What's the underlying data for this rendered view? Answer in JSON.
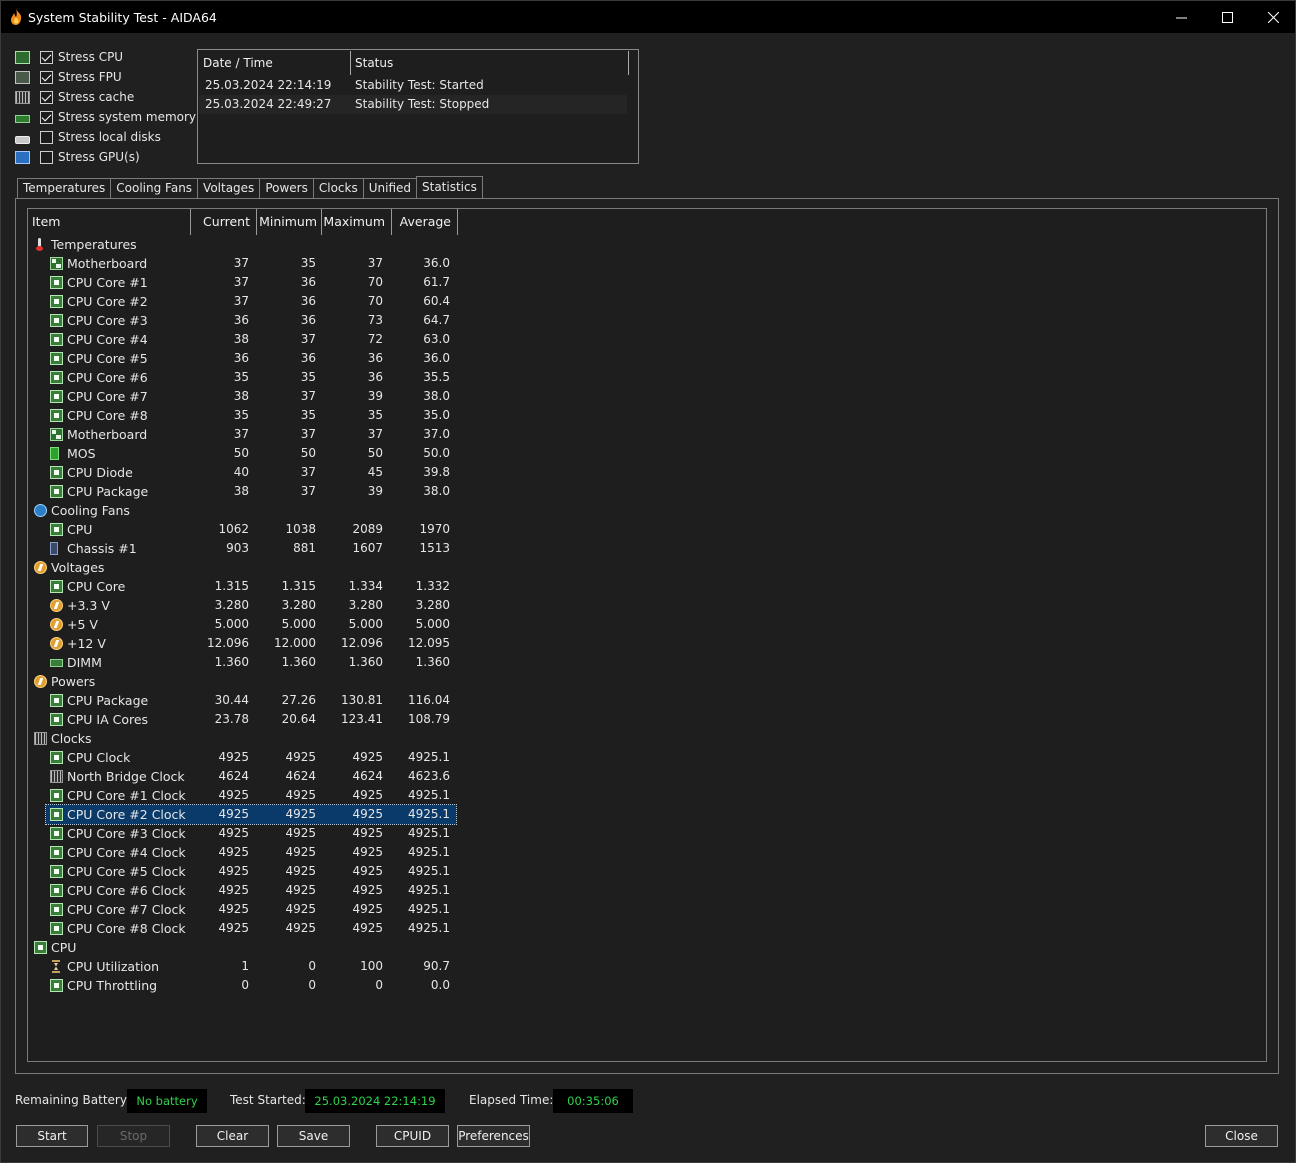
{
  "window": {
    "title": "System Stability Test - AIDA64"
  },
  "stress_options": [
    {
      "label": "Stress CPU",
      "checked": true,
      "icon": "cpu-icon"
    },
    {
      "label": "Stress FPU",
      "checked": true,
      "icon": "fpu-icon"
    },
    {
      "label": "Stress cache",
      "checked": true,
      "icon": "cache-icon"
    },
    {
      "label": "Stress system memory",
      "checked": true,
      "icon": "memory-icon"
    },
    {
      "label": "Stress local disks",
      "checked": false,
      "icon": "disk-icon"
    },
    {
      "label": "Stress GPU(s)",
      "checked": false,
      "icon": "gpu-icon"
    }
  ],
  "log": {
    "columns": [
      "Date / Time",
      "Status"
    ],
    "rows": [
      [
        "25.03.2024 22:14:19",
        "Stability Test: Started"
      ],
      [
        "25.03.2024 22:49:27",
        "Stability Test: Stopped"
      ]
    ]
  },
  "tabs": [
    "Temperatures",
    "Cooling Fans",
    "Voltages",
    "Powers",
    "Clocks",
    "Unified",
    "Statistics"
  ],
  "active_tab": "Statistics",
  "grid": {
    "columns": [
      "Item",
      "Current",
      "Minimum",
      "Maximum",
      "Average"
    ],
    "rows": [
      {
        "group": true,
        "icon": "therm",
        "name": "Temperatures"
      },
      {
        "icon": "mb",
        "name": "Motherboard",
        "cur": "37",
        "min": "35",
        "max": "37",
        "avg": "36.0"
      },
      {
        "icon": "chip",
        "name": "CPU Core #1",
        "cur": "37",
        "min": "36",
        "max": "70",
        "avg": "61.7"
      },
      {
        "icon": "chip",
        "name": "CPU Core #2",
        "cur": "37",
        "min": "36",
        "max": "70",
        "avg": "60.4"
      },
      {
        "icon": "chip",
        "name": "CPU Core #3",
        "cur": "36",
        "min": "36",
        "max": "73",
        "avg": "64.7"
      },
      {
        "icon": "chip",
        "name": "CPU Core #4",
        "cur": "38",
        "min": "37",
        "max": "72",
        "avg": "63.0"
      },
      {
        "icon": "chip",
        "name": "CPU Core #5",
        "cur": "36",
        "min": "36",
        "max": "36",
        "avg": "36.0"
      },
      {
        "icon": "chip",
        "name": "CPU Core #6",
        "cur": "35",
        "min": "35",
        "max": "36",
        "avg": "35.5"
      },
      {
        "icon": "chip",
        "name": "CPU Core #7",
        "cur": "38",
        "min": "37",
        "max": "39",
        "avg": "38.0"
      },
      {
        "icon": "chip",
        "name": "CPU Core #8",
        "cur": "35",
        "min": "35",
        "max": "35",
        "avg": "35.0"
      },
      {
        "icon": "mb",
        "name": "Motherboard",
        "cur": "37",
        "min": "37",
        "max": "37",
        "avg": "37.0"
      },
      {
        "icon": "bat",
        "name": "MOS",
        "cur": "50",
        "min": "50",
        "max": "50",
        "avg": "50.0"
      },
      {
        "icon": "chip",
        "name": "CPU Diode",
        "cur": "40",
        "min": "37",
        "max": "45",
        "avg": "39.8"
      },
      {
        "icon": "chip",
        "name": "CPU Package",
        "cur": "38",
        "min": "37",
        "max": "39",
        "avg": "38.0"
      },
      {
        "group": true,
        "icon": "fan",
        "name": "Cooling Fans"
      },
      {
        "icon": "chip",
        "name": "CPU",
        "cur": "1062",
        "min": "1038",
        "max": "2089",
        "avg": "1970"
      },
      {
        "icon": "chassis",
        "name": "Chassis #1",
        "cur": "903",
        "min": "881",
        "max": "1607",
        "avg": "1513"
      },
      {
        "group": true,
        "icon": "volt",
        "name": "Voltages"
      },
      {
        "icon": "chip",
        "name": "CPU Core",
        "cur": "1.315",
        "min": "1.315",
        "max": "1.334",
        "avg": "1.332"
      },
      {
        "icon": "volt",
        "name": "+3.3 V",
        "cur": "3.280",
        "min": "3.280",
        "max": "3.280",
        "avg": "3.280"
      },
      {
        "icon": "volt",
        "name": "+5 V",
        "cur": "5.000",
        "min": "5.000",
        "max": "5.000",
        "avg": "5.000"
      },
      {
        "icon": "volt",
        "name": "+12 V",
        "cur": "12.096",
        "min": "12.000",
        "max": "12.096",
        "avg": "12.095"
      },
      {
        "icon": "dimm",
        "name": "DIMM",
        "cur": "1.360",
        "min": "1.360",
        "max": "1.360",
        "avg": "1.360"
      },
      {
        "group": true,
        "icon": "volt",
        "name": "Powers"
      },
      {
        "icon": "chip",
        "name": "CPU Package",
        "cur": "30.44",
        "min": "27.26",
        "max": "130.81",
        "avg": "116.04"
      },
      {
        "icon": "chip",
        "name": "CPU IA Cores",
        "cur": "23.78",
        "min": "20.64",
        "max": "123.41",
        "avg": "108.79"
      },
      {
        "group": true,
        "icon": "clk",
        "name": "Clocks"
      },
      {
        "icon": "chip",
        "name": "CPU Clock",
        "cur": "4925",
        "min": "4925",
        "max": "4925",
        "avg": "4925.1"
      },
      {
        "icon": "clk",
        "name": "North Bridge Clock",
        "cur": "4624",
        "min": "4624",
        "max": "4624",
        "avg": "4623.6"
      },
      {
        "icon": "chip",
        "name": "CPU Core #1 Clock",
        "cur": "4925",
        "min": "4925",
        "max": "4925",
        "avg": "4925.1"
      },
      {
        "icon": "chip",
        "name": "CPU Core #2 Clock",
        "cur": "4925",
        "min": "4925",
        "max": "4925",
        "avg": "4925.1",
        "selected": true
      },
      {
        "icon": "chip",
        "name": "CPU Core #3 Clock",
        "cur": "4925",
        "min": "4925",
        "max": "4925",
        "avg": "4925.1"
      },
      {
        "icon": "chip",
        "name": "CPU Core #4 Clock",
        "cur": "4925",
        "min": "4925",
        "max": "4925",
        "avg": "4925.1"
      },
      {
        "icon": "chip",
        "name": "CPU Core #5 Clock",
        "cur": "4925",
        "min": "4925",
        "max": "4925",
        "avg": "4925.1"
      },
      {
        "icon": "chip",
        "name": "CPU Core #6 Clock",
        "cur": "4925",
        "min": "4925",
        "max": "4925",
        "avg": "4925.1"
      },
      {
        "icon": "chip",
        "name": "CPU Core #7 Clock",
        "cur": "4925",
        "min": "4925",
        "max": "4925",
        "avg": "4925.1"
      },
      {
        "icon": "chip",
        "name": "CPU Core #8 Clock",
        "cur": "4925",
        "min": "4925",
        "max": "4925",
        "avg": "4925.1"
      },
      {
        "group": true,
        "icon": "chip",
        "name": "CPU"
      },
      {
        "icon": "hour",
        "name": "CPU Utilization",
        "cur": "1",
        "min": "0",
        "max": "100",
        "avg": "90.7"
      },
      {
        "icon": "chip",
        "name": "CPU Throttling",
        "cur": "0",
        "min": "0",
        "max": "0",
        "avg": "0.0"
      }
    ]
  },
  "status": {
    "battery_label": "Remaining Battery:",
    "battery_value": "No battery",
    "started_label": "Test Started:",
    "started_value": "25.03.2024 22:14:19",
    "elapsed_label": "Elapsed Time:",
    "elapsed_value": "00:35:06"
  },
  "buttons": {
    "start": "Start",
    "stop": "Stop",
    "clear": "Clear",
    "save": "Save",
    "cpuid": "CPUID",
    "preferences": "Preferences",
    "close": "Close"
  },
  "colors": {
    "accent_green": "#2fd24a",
    "selection": "#0a3a6a"
  }
}
